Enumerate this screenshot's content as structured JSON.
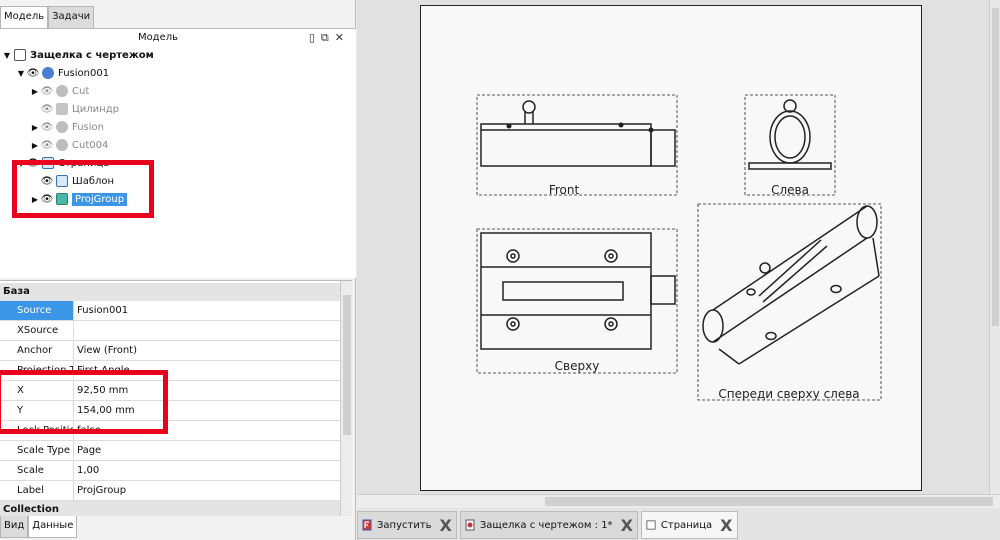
{
  "top_tabs": [
    "Модель",
    "Задачи"
  ],
  "tree": {
    "title": "Модель",
    "items": [
      {
        "label": "Защелка с чертежом"
      },
      {
        "label": "Fusion001"
      },
      {
        "label": "Cut"
      },
      {
        "label": "Цилиндр"
      },
      {
        "label": "Fusion"
      },
      {
        "label": "Cut004"
      },
      {
        "label": "Страница"
      },
      {
        "label": "Шаблон"
      },
      {
        "label": "ProjGroup"
      }
    ]
  },
  "properties": {
    "group_base": "База",
    "rows": [
      {
        "key": "Source",
        "value": "Fusion001"
      },
      {
        "key": "XSource",
        "value": ""
      },
      {
        "key": "Anchor",
        "value": "View (Front)"
      },
      {
        "key": "Projection T",
        "value": "First Angle"
      },
      {
        "key": "X",
        "value": "92,50 mm"
      },
      {
        "key": "Y",
        "value": "154,00 mm"
      },
      {
        "key": "Lock Positio",
        "value": "false"
      },
      {
        "key": "Scale Type",
        "value": "Page"
      },
      {
        "key": "Scale",
        "value": "1,00"
      },
      {
        "key": "Label",
        "value": "ProjGroup"
      }
    ],
    "group_collection": "Collection"
  },
  "bottom_tabs": [
    "Вид",
    "Данные"
  ],
  "drawing": {
    "views": [
      "Front",
      "Слева",
      "Сверху",
      "Спереди сверху слева"
    ]
  },
  "doc_tabs": [
    {
      "label": "Запустить"
    },
    {
      "label": "Защелка с чертежом : 1*"
    },
    {
      "label": "Страница"
    }
  ],
  "colors": {
    "selection": "#3b97e6",
    "highlight_box": "#e8001c"
  }
}
